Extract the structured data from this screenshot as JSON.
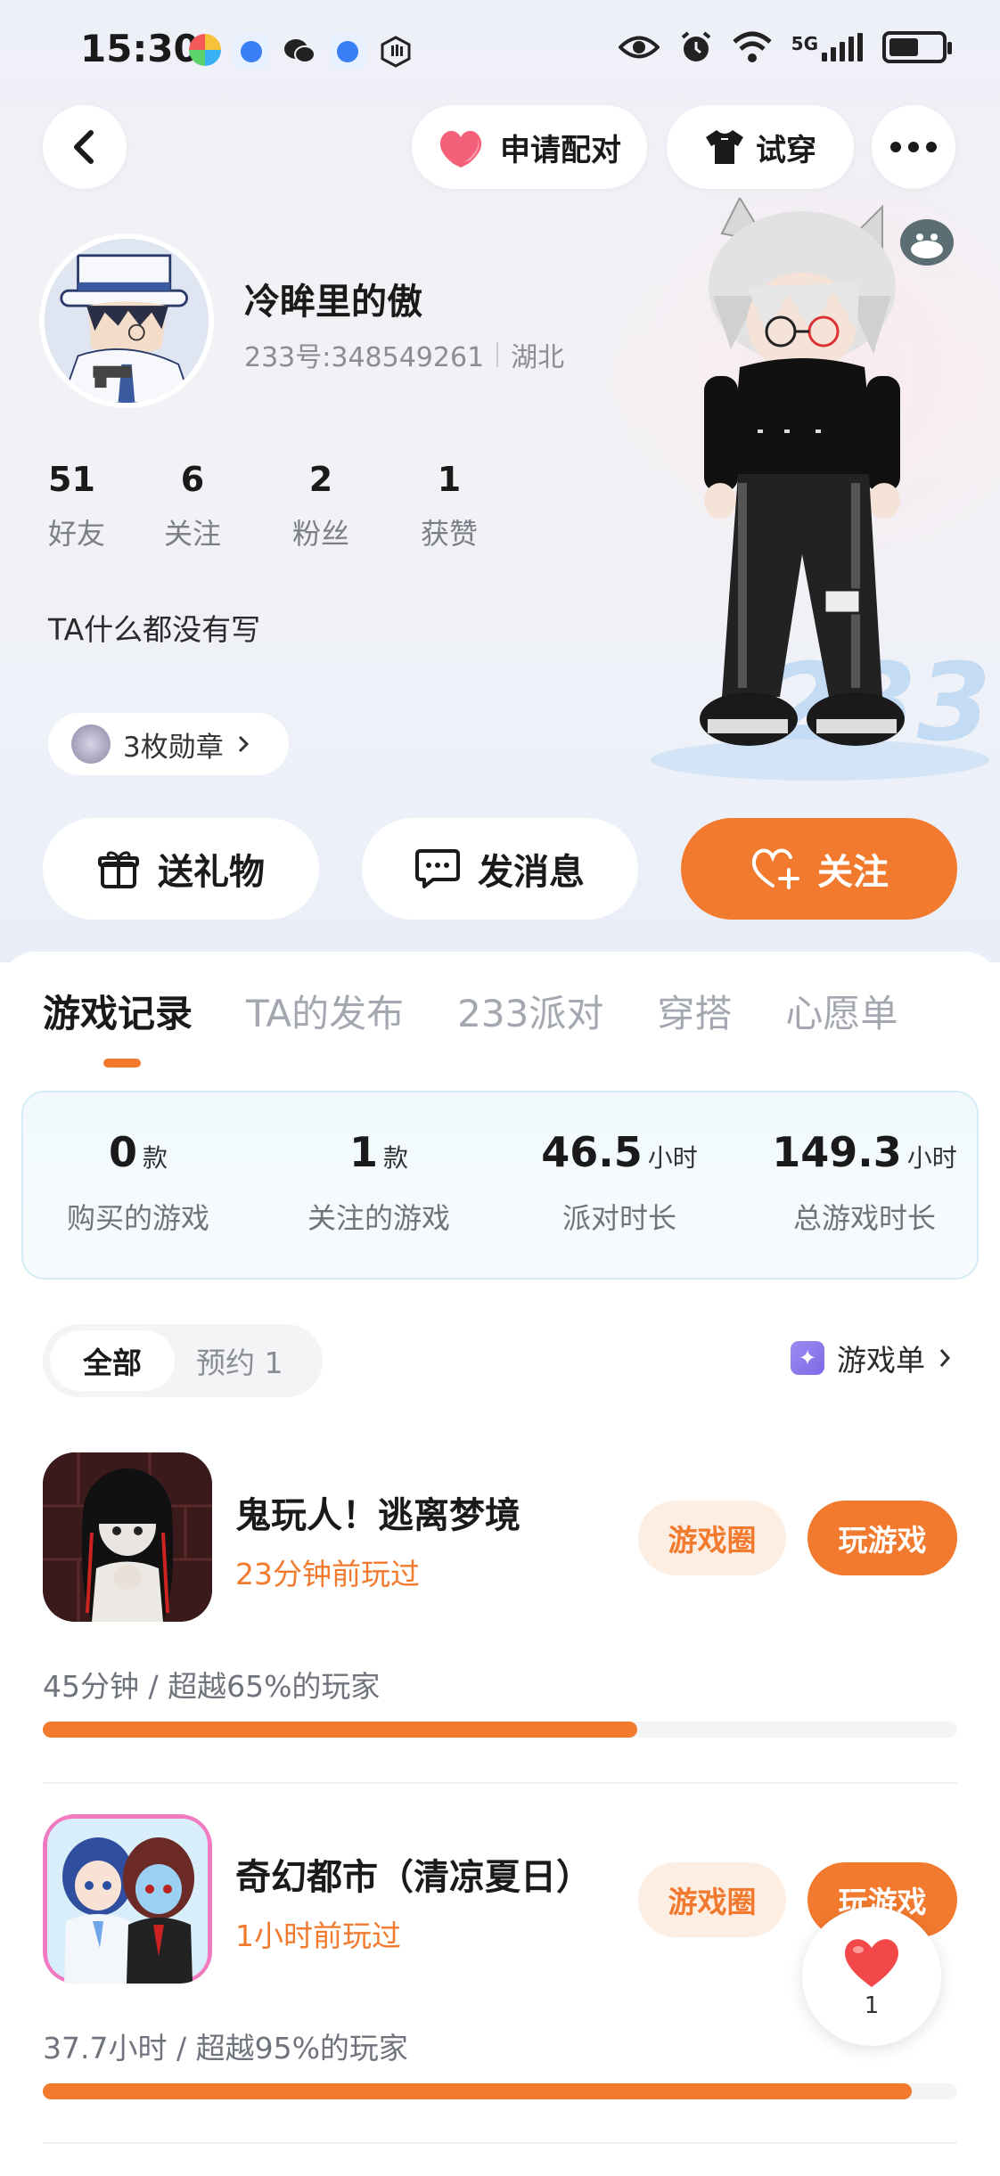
{
  "status_bar": {
    "time": "15:30",
    "network": "5G"
  },
  "top_actions": {
    "pair_label": "申请配对",
    "try_label": "试穿"
  },
  "profile": {
    "nickname": "冷眸里的傲",
    "uid": "233号:348549261",
    "region": "湖北",
    "bio": "TA什么都没有写",
    "badges": "3枚勋章"
  },
  "stats": [
    {
      "value": "51",
      "label": "好友"
    },
    {
      "value": "6",
      "label": "关注"
    },
    {
      "value": "2",
      "label": "粉丝"
    },
    {
      "value": "1",
      "label": "获赞"
    }
  ],
  "actions": {
    "gift": "送礼物",
    "message": "发消息",
    "follow": "关注"
  },
  "tabs": [
    "游戏记录",
    "TA的发布",
    "233派对",
    "穿搭",
    "心愿单"
  ],
  "game_stats": [
    {
      "value": "0",
      "unit": "款",
      "label": "购买的游戏"
    },
    {
      "value": "1",
      "unit": "款",
      "label": "关注的游戏"
    },
    {
      "value": "46.5",
      "unit": "小时",
      "label": "派对时长"
    },
    {
      "value": "149.3",
      "unit": "小时",
      "label": "总游戏时长"
    }
  ],
  "filters": {
    "all": "全部",
    "reserved": "预约 1"
  },
  "game_list_link": "游戏单",
  "games": [
    {
      "title": "鬼玩人！逃离梦境",
      "played": "23分钟前玩过",
      "circle": "游戏圈",
      "play": "玩游戏",
      "stat": "45分钟 / 超越65%的玩家",
      "progress": 0.65
    },
    {
      "title": "奇幻都市（清凉夏日）",
      "played": "1小时前玩过",
      "circle": "游戏圈",
      "play": "玩游戏",
      "stat": "37.7小时 / 超越95%的玩家",
      "progress": 0.95
    }
  ],
  "like_fab": {
    "count": "1"
  },
  "colors": {
    "accent": "#f27a2e",
    "accent_light": "#fdeee3"
  }
}
